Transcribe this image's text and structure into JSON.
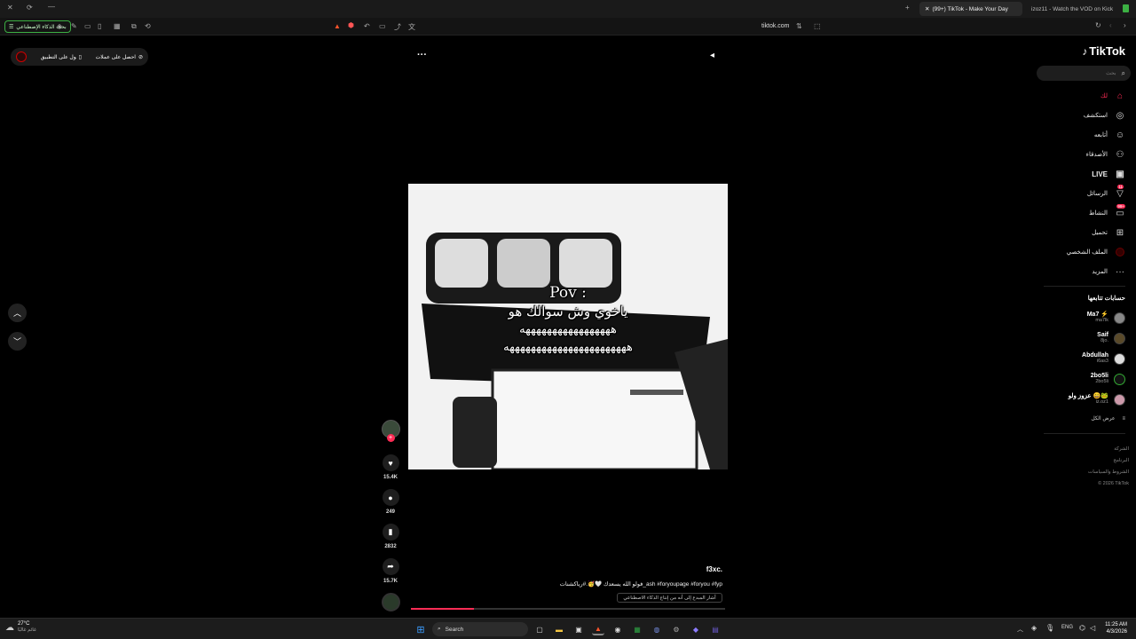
{
  "browser": {
    "tabs": [
      {
        "label": "(99+) TikTok - Make Your Day",
        "active": true
      },
      {
        "label": "izoz11 - Watch the VOD on Kick",
        "active": false
      }
    ],
    "address": "tiktok.com",
    "left_button": "بحث الذكاء الإصطناعي"
  },
  "promo": {
    "get_coins": "احصل على عملات",
    "get_app": "الحصول على التطبيق"
  },
  "video": {
    "overlay_line1": "Pov :",
    "overlay_line2": "ياخوي وش سوالك هو",
    "overlay_line3": "هههههههههههههههههه",
    "overlay_line4": "هههههههههههههههههههههههه",
    "author": "f3xc.",
    "caption": "فولو الله يسعدك 🤍🥳.#رياكشنات_ash #foryoupage #foryou #fyp",
    "ai_label": "أشار المبدع إلى أنه من إنتاج الذكاء الاصطناعي",
    "progress": 0.2
  },
  "actions": {
    "likes": "15.4K",
    "comments": "249",
    "saves": "2832",
    "shares": "15.7K"
  },
  "sidebar": {
    "logo": "TikTok",
    "search_placeholder": "بحث",
    "nav": [
      {
        "label": "لك",
        "icon": "home-icon"
      },
      {
        "label": "استكشف",
        "icon": "compass-icon"
      },
      {
        "label": "أتابعه",
        "icon": "following-icon"
      },
      {
        "label": "الأصدقاء",
        "icon": "friends-icon"
      },
      {
        "label": "LIVE",
        "icon": "live-icon"
      },
      {
        "label": "الرسائل",
        "icon": "messages-icon",
        "badge": "11"
      },
      {
        "label": "النشاط",
        "icon": "activity-icon",
        "badge": "99+"
      },
      {
        "label": "تحميل",
        "icon": "upload-icon"
      },
      {
        "label": "الملف الشخصي",
        "icon": "profile-icon"
      },
      {
        "label": "المزيد",
        "icon": "more-icon"
      }
    ],
    "following_title": "حسابات تتابعها",
    "accounts": [
      {
        "name": "Ma7 ⚡",
        "handle": "ma7lk"
      },
      {
        "name": "Saif",
        "handle": "8jo."
      },
      {
        "name": "Abdullah",
        "handle": "i6as3"
      },
      {
        "name": "2bo5li",
        "handle": "2bo5li"
      },
      {
        "name": "عزوز ولو 😄🐸",
        "handle": "iz.oz1"
      }
    ],
    "see_all": "عرض الكل",
    "footer": [
      "الشركة",
      "البرنامج",
      "الشروط والسياسات",
      "© 2026 TikTok"
    ]
  },
  "taskbar": {
    "weather_temp": "27°C",
    "weather_desc": "غائم غالبًا",
    "search": "Search",
    "lang": "ENG",
    "time": "11:25 AM",
    "date": "4/3/2026"
  },
  "colors": {
    "accent": "#fe2c55",
    "brand_green": "#3cb043"
  }
}
